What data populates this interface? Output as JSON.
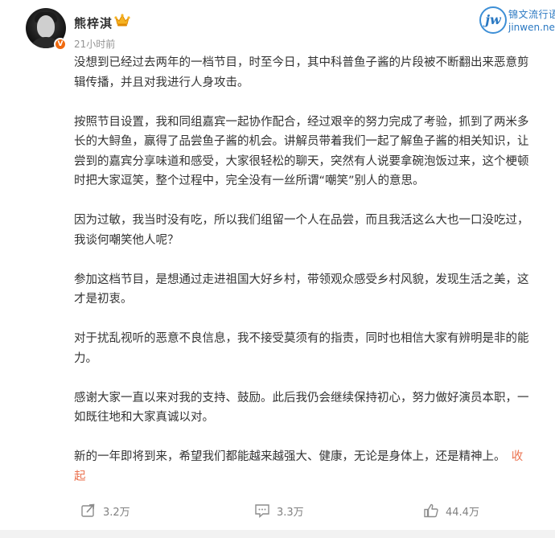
{
  "post": {
    "username": "熊梓淇",
    "verified_badge": "V",
    "timestamp": "21小时前",
    "paragraphs": [
      "没想到已经过去两年的一档节目，时至今日，其中科普鱼子酱的片段被不断翻出来恶意剪辑传播，并且对我进行人身攻击。",
      "按照节目设置，我和同组嘉宾一起协作配合，经过艰辛的努力完成了考验，抓到了两米多长的大鲟鱼，赢得了品尝鱼子酱的机会。讲解员带着我们一起了解鱼子酱的相关知识，让尝到的嘉宾分享味道和感受，大家很轻松的聊天，突然有人说要拿碗泡饭过来，这个梗顿时把大家逗笑，整个过程中，完全没有一丝所谓“嘲笑”别人的意思。",
      "因为过敏，我当时没有吃，所以我们组留一个人在品尝，而且我活这么大也一口没吃过，我谈何嘲笑他人呢？",
      "参加这档节目，是想通过走进祖国大好乡村，带领观众感受乡村风貌，发现生活之美，这才是初衷。",
      "对于扰乱视听的恶意不良信息，我不接受莫须有的指责，同时也相信大家有辨明是非的能力。",
      "感谢大家一直以来对我的支持、鼓励。此后我仍会继续保持初心，努力做好演员本职，一如既往地和大家真诚以对。",
      "新的一年即将到来，希望我们都能越来越强大、健康，无论是身体上，还是精神上。"
    ],
    "collapse_label": "收起"
  },
  "watermark": {
    "logo_letters": "jw",
    "line1": "锦文流行语",
    "line2": "jinwen.net"
  },
  "actions": {
    "repost_count": "3.2万",
    "comment_count": "3.3万",
    "like_count": "44.4万"
  },
  "colors": {
    "text": "#333333",
    "muted": "#939393",
    "accent": "#eb7350",
    "verified": "#f06a0f",
    "watermark": "#2a78c2"
  },
  "icons": [
    "crown-icon",
    "repost-icon",
    "comment-icon",
    "like-icon"
  ]
}
